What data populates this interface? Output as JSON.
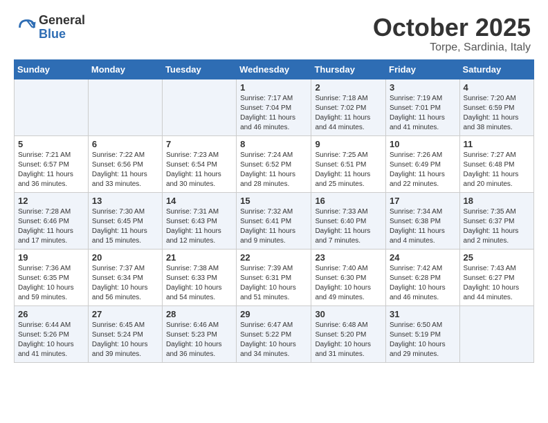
{
  "header": {
    "logo_general": "General",
    "logo_blue": "Blue",
    "month_title": "October 2025",
    "location": "Torpe, Sardinia, Italy"
  },
  "days_of_week": [
    "Sunday",
    "Monday",
    "Tuesday",
    "Wednesday",
    "Thursday",
    "Friday",
    "Saturday"
  ],
  "weeks": [
    [
      {
        "day": "",
        "info": ""
      },
      {
        "day": "",
        "info": ""
      },
      {
        "day": "",
        "info": ""
      },
      {
        "day": "1",
        "info": "Sunrise: 7:17 AM\nSunset: 7:04 PM\nDaylight: 11 hours\nand 46 minutes."
      },
      {
        "day": "2",
        "info": "Sunrise: 7:18 AM\nSunset: 7:02 PM\nDaylight: 11 hours\nand 44 minutes."
      },
      {
        "day": "3",
        "info": "Sunrise: 7:19 AM\nSunset: 7:01 PM\nDaylight: 11 hours\nand 41 minutes."
      },
      {
        "day": "4",
        "info": "Sunrise: 7:20 AM\nSunset: 6:59 PM\nDaylight: 11 hours\nand 38 minutes."
      }
    ],
    [
      {
        "day": "5",
        "info": "Sunrise: 7:21 AM\nSunset: 6:57 PM\nDaylight: 11 hours\nand 36 minutes."
      },
      {
        "day": "6",
        "info": "Sunrise: 7:22 AM\nSunset: 6:56 PM\nDaylight: 11 hours\nand 33 minutes."
      },
      {
        "day": "7",
        "info": "Sunrise: 7:23 AM\nSunset: 6:54 PM\nDaylight: 11 hours\nand 30 minutes."
      },
      {
        "day": "8",
        "info": "Sunrise: 7:24 AM\nSunset: 6:52 PM\nDaylight: 11 hours\nand 28 minutes."
      },
      {
        "day": "9",
        "info": "Sunrise: 7:25 AM\nSunset: 6:51 PM\nDaylight: 11 hours\nand 25 minutes."
      },
      {
        "day": "10",
        "info": "Sunrise: 7:26 AM\nSunset: 6:49 PM\nDaylight: 11 hours\nand 22 minutes."
      },
      {
        "day": "11",
        "info": "Sunrise: 7:27 AM\nSunset: 6:48 PM\nDaylight: 11 hours\nand 20 minutes."
      }
    ],
    [
      {
        "day": "12",
        "info": "Sunrise: 7:28 AM\nSunset: 6:46 PM\nDaylight: 11 hours\nand 17 minutes."
      },
      {
        "day": "13",
        "info": "Sunrise: 7:30 AM\nSunset: 6:45 PM\nDaylight: 11 hours\nand 15 minutes."
      },
      {
        "day": "14",
        "info": "Sunrise: 7:31 AM\nSunset: 6:43 PM\nDaylight: 11 hours\nand 12 minutes."
      },
      {
        "day": "15",
        "info": "Sunrise: 7:32 AM\nSunset: 6:41 PM\nDaylight: 11 hours\nand 9 minutes."
      },
      {
        "day": "16",
        "info": "Sunrise: 7:33 AM\nSunset: 6:40 PM\nDaylight: 11 hours\nand 7 minutes."
      },
      {
        "day": "17",
        "info": "Sunrise: 7:34 AM\nSunset: 6:38 PM\nDaylight: 11 hours\nand 4 minutes."
      },
      {
        "day": "18",
        "info": "Sunrise: 7:35 AM\nSunset: 6:37 PM\nDaylight: 11 hours\nand 2 minutes."
      }
    ],
    [
      {
        "day": "19",
        "info": "Sunrise: 7:36 AM\nSunset: 6:35 PM\nDaylight: 10 hours\nand 59 minutes."
      },
      {
        "day": "20",
        "info": "Sunrise: 7:37 AM\nSunset: 6:34 PM\nDaylight: 10 hours\nand 56 minutes."
      },
      {
        "day": "21",
        "info": "Sunrise: 7:38 AM\nSunset: 6:33 PM\nDaylight: 10 hours\nand 54 minutes."
      },
      {
        "day": "22",
        "info": "Sunrise: 7:39 AM\nSunset: 6:31 PM\nDaylight: 10 hours\nand 51 minutes."
      },
      {
        "day": "23",
        "info": "Sunrise: 7:40 AM\nSunset: 6:30 PM\nDaylight: 10 hours\nand 49 minutes."
      },
      {
        "day": "24",
        "info": "Sunrise: 7:42 AM\nSunset: 6:28 PM\nDaylight: 10 hours\nand 46 minutes."
      },
      {
        "day": "25",
        "info": "Sunrise: 7:43 AM\nSunset: 6:27 PM\nDaylight: 10 hours\nand 44 minutes."
      }
    ],
    [
      {
        "day": "26",
        "info": "Sunrise: 6:44 AM\nSunset: 5:26 PM\nDaylight: 10 hours\nand 41 minutes."
      },
      {
        "day": "27",
        "info": "Sunrise: 6:45 AM\nSunset: 5:24 PM\nDaylight: 10 hours\nand 39 minutes."
      },
      {
        "day": "28",
        "info": "Sunrise: 6:46 AM\nSunset: 5:23 PM\nDaylight: 10 hours\nand 36 minutes."
      },
      {
        "day": "29",
        "info": "Sunrise: 6:47 AM\nSunset: 5:22 PM\nDaylight: 10 hours\nand 34 minutes."
      },
      {
        "day": "30",
        "info": "Sunrise: 6:48 AM\nSunset: 5:20 PM\nDaylight: 10 hours\nand 31 minutes."
      },
      {
        "day": "31",
        "info": "Sunrise: 6:50 AM\nSunset: 5:19 PM\nDaylight: 10 hours\nand 29 minutes."
      },
      {
        "day": "",
        "info": ""
      }
    ]
  ]
}
